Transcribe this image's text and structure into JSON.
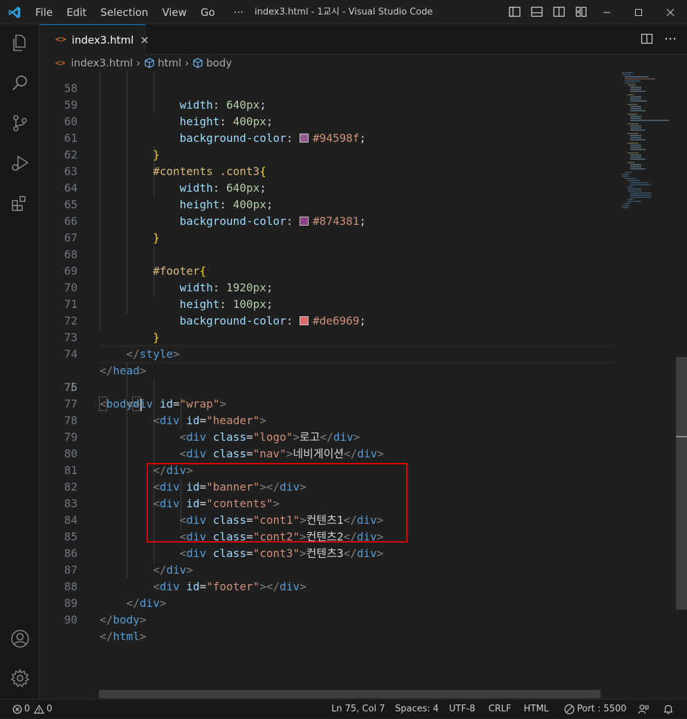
{
  "titlebar": {
    "menu": [
      "File",
      "Edit",
      "Selection",
      "View",
      "Go",
      "···"
    ],
    "title": "index3.html - 1교시 - Visual Studio Code"
  },
  "tab": {
    "label": "index3.html",
    "icon": "<>",
    "close": "×"
  },
  "breadcrumb": {
    "file": "index3.html",
    "sep": "›",
    "item1": "html",
    "item2": "body"
  },
  "line_numbers": [
    "58",
    "59",
    "60",
    "61",
    "62",
    "63",
    "64",
    "65",
    "66",
    "67",
    "68",
    "69",
    "70",
    "71",
    "72",
    "73",
    "74",
    "75",
    "76",
    "77",
    "78",
    "79",
    "80",
    "81",
    "82",
    "83",
    "84",
    "85",
    "86",
    "87",
    "88",
    "89",
    "90"
  ],
  "code": {
    "l58": [
      "width",
      ": ",
      "640",
      "px",
      ";"
    ],
    "l59": [
      "height",
      ": ",
      "400",
      "px",
      ";"
    ],
    "l60": [
      "background-color",
      ": ",
      "#94598f",
      ";"
    ],
    "l61": "}",
    "l62": [
      "#contents .cont3",
      "{"
    ],
    "l63": [
      "width",
      ": ",
      "640",
      "px",
      ";"
    ],
    "l64": [
      "height",
      ": ",
      "400",
      "px",
      ";"
    ],
    "l65": [
      "background-color",
      ": ",
      "#874381",
      ";"
    ],
    "l66": "}",
    "l68": [
      "#footer",
      "{"
    ],
    "l69": [
      "width",
      ": ",
      "1920",
      "px",
      ";"
    ],
    "l70": [
      "height",
      ": ",
      "100",
      "px",
      ";"
    ],
    "l71": [
      "background-color",
      ": ",
      "#de6969",
      ";"
    ],
    "l72": "}",
    "l73": [
      "</",
      "style",
      ">"
    ],
    "l74": [
      "</",
      "head",
      ">"
    ],
    "l75": [
      "<",
      "body",
      ">"
    ],
    "l76": [
      "<",
      "div",
      " ",
      "id",
      "=",
      "\"wrap\"",
      ">"
    ],
    "l77": [
      "<",
      "div",
      " ",
      "id",
      "=",
      "\"header\"",
      ">"
    ],
    "l78": [
      "<",
      "div",
      " ",
      "class",
      "=",
      "\"logo\"",
      ">",
      "로고",
      "</",
      "div",
      ">"
    ],
    "l79": [
      "<",
      "div",
      " ",
      "class",
      "=",
      "\"nav\"",
      ">",
      "네비게이션",
      "</",
      "div",
      ">"
    ],
    "l80": [
      "</",
      "div",
      ">"
    ],
    "l81": [
      "<",
      "div",
      " ",
      "id",
      "=",
      "\"banner\"",
      "></",
      "div",
      ">"
    ],
    "l82": [
      "<",
      "div",
      " ",
      "id",
      "=",
      "\"contents\"",
      ">"
    ],
    "l83": [
      "<",
      "div",
      " ",
      "class",
      "=",
      "\"cont1\"",
      ">",
      "컨텐츠1",
      "</",
      "div",
      ">"
    ],
    "l84": [
      "<",
      "div",
      " ",
      "class",
      "=",
      "\"cont2\"",
      ">",
      "컨텐츠2",
      "</",
      "div",
      ">"
    ],
    "l85": [
      "<",
      "div",
      " ",
      "class",
      "=",
      "\"cont3\"",
      ">",
      "컨텐츠3",
      "</",
      "div",
      ">"
    ],
    "l86": [
      "</",
      "div",
      ">"
    ],
    "l87": [
      "<",
      "div",
      " ",
      "id",
      "=",
      "\"footer\"",
      "></",
      "div",
      ">"
    ],
    "l88": [
      "</",
      "div",
      ">"
    ],
    "l89": [
      "</",
      "body",
      ">"
    ],
    "l90": [
      "</",
      "html",
      ">"
    ]
  },
  "colors": {
    "swatch60": "#94598f",
    "swatch65": "#874381",
    "swatch71": "#de6969",
    "accent": "#0078d4",
    "highlight": "#e00000"
  },
  "statusbar": {
    "errors": "0",
    "warnings": "0",
    "position": "Ln 75, Col 7",
    "spaces": "Spaces: 4",
    "encoding": "UTF-8",
    "eol": "CRLF",
    "language": "HTML",
    "port": "Port : 5500"
  }
}
